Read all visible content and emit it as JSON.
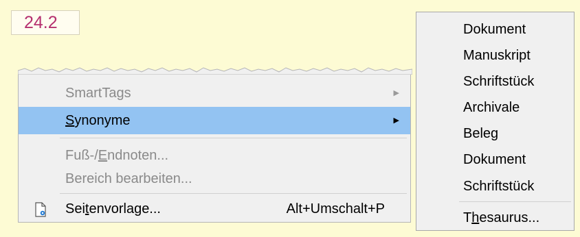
{
  "number_box": "24.2",
  "context_menu": {
    "items": [
      {
        "label": "SmartTags",
        "state": "disabled",
        "submenu": true
      },
      {
        "label_pre": "",
        "mnemonic": "S",
        "label_post": "ynonyme",
        "state": "highlighted",
        "submenu": true
      },
      {
        "label_pre": "Fuß-/",
        "mnemonic": "E",
        "label_post": "ndnoten...",
        "state": "disabled"
      },
      {
        "label": "Bereich bearbeiten...",
        "state": "disabled"
      },
      {
        "label_pre": "Sei",
        "mnemonic": "t",
        "label_post": "envorlage...",
        "shortcut": "Alt+Umschalt+P",
        "icon": "page-style-icon",
        "state": "enabled"
      }
    ]
  },
  "synonyms_submenu": {
    "items": [
      "Dokument",
      "Manuskript",
      "Schriftstück",
      "Archivale",
      "Beleg",
      "Dokument",
      "Schriftstück"
    ],
    "thesaurus": {
      "pre": "T",
      "mnemonic": "h",
      "post": "esaurus..."
    }
  },
  "colors": {
    "background": "#fdfbd4",
    "highlight": "#93c3f2",
    "number_text": "#b5306f",
    "disabled_text": "#8a8a8a"
  }
}
